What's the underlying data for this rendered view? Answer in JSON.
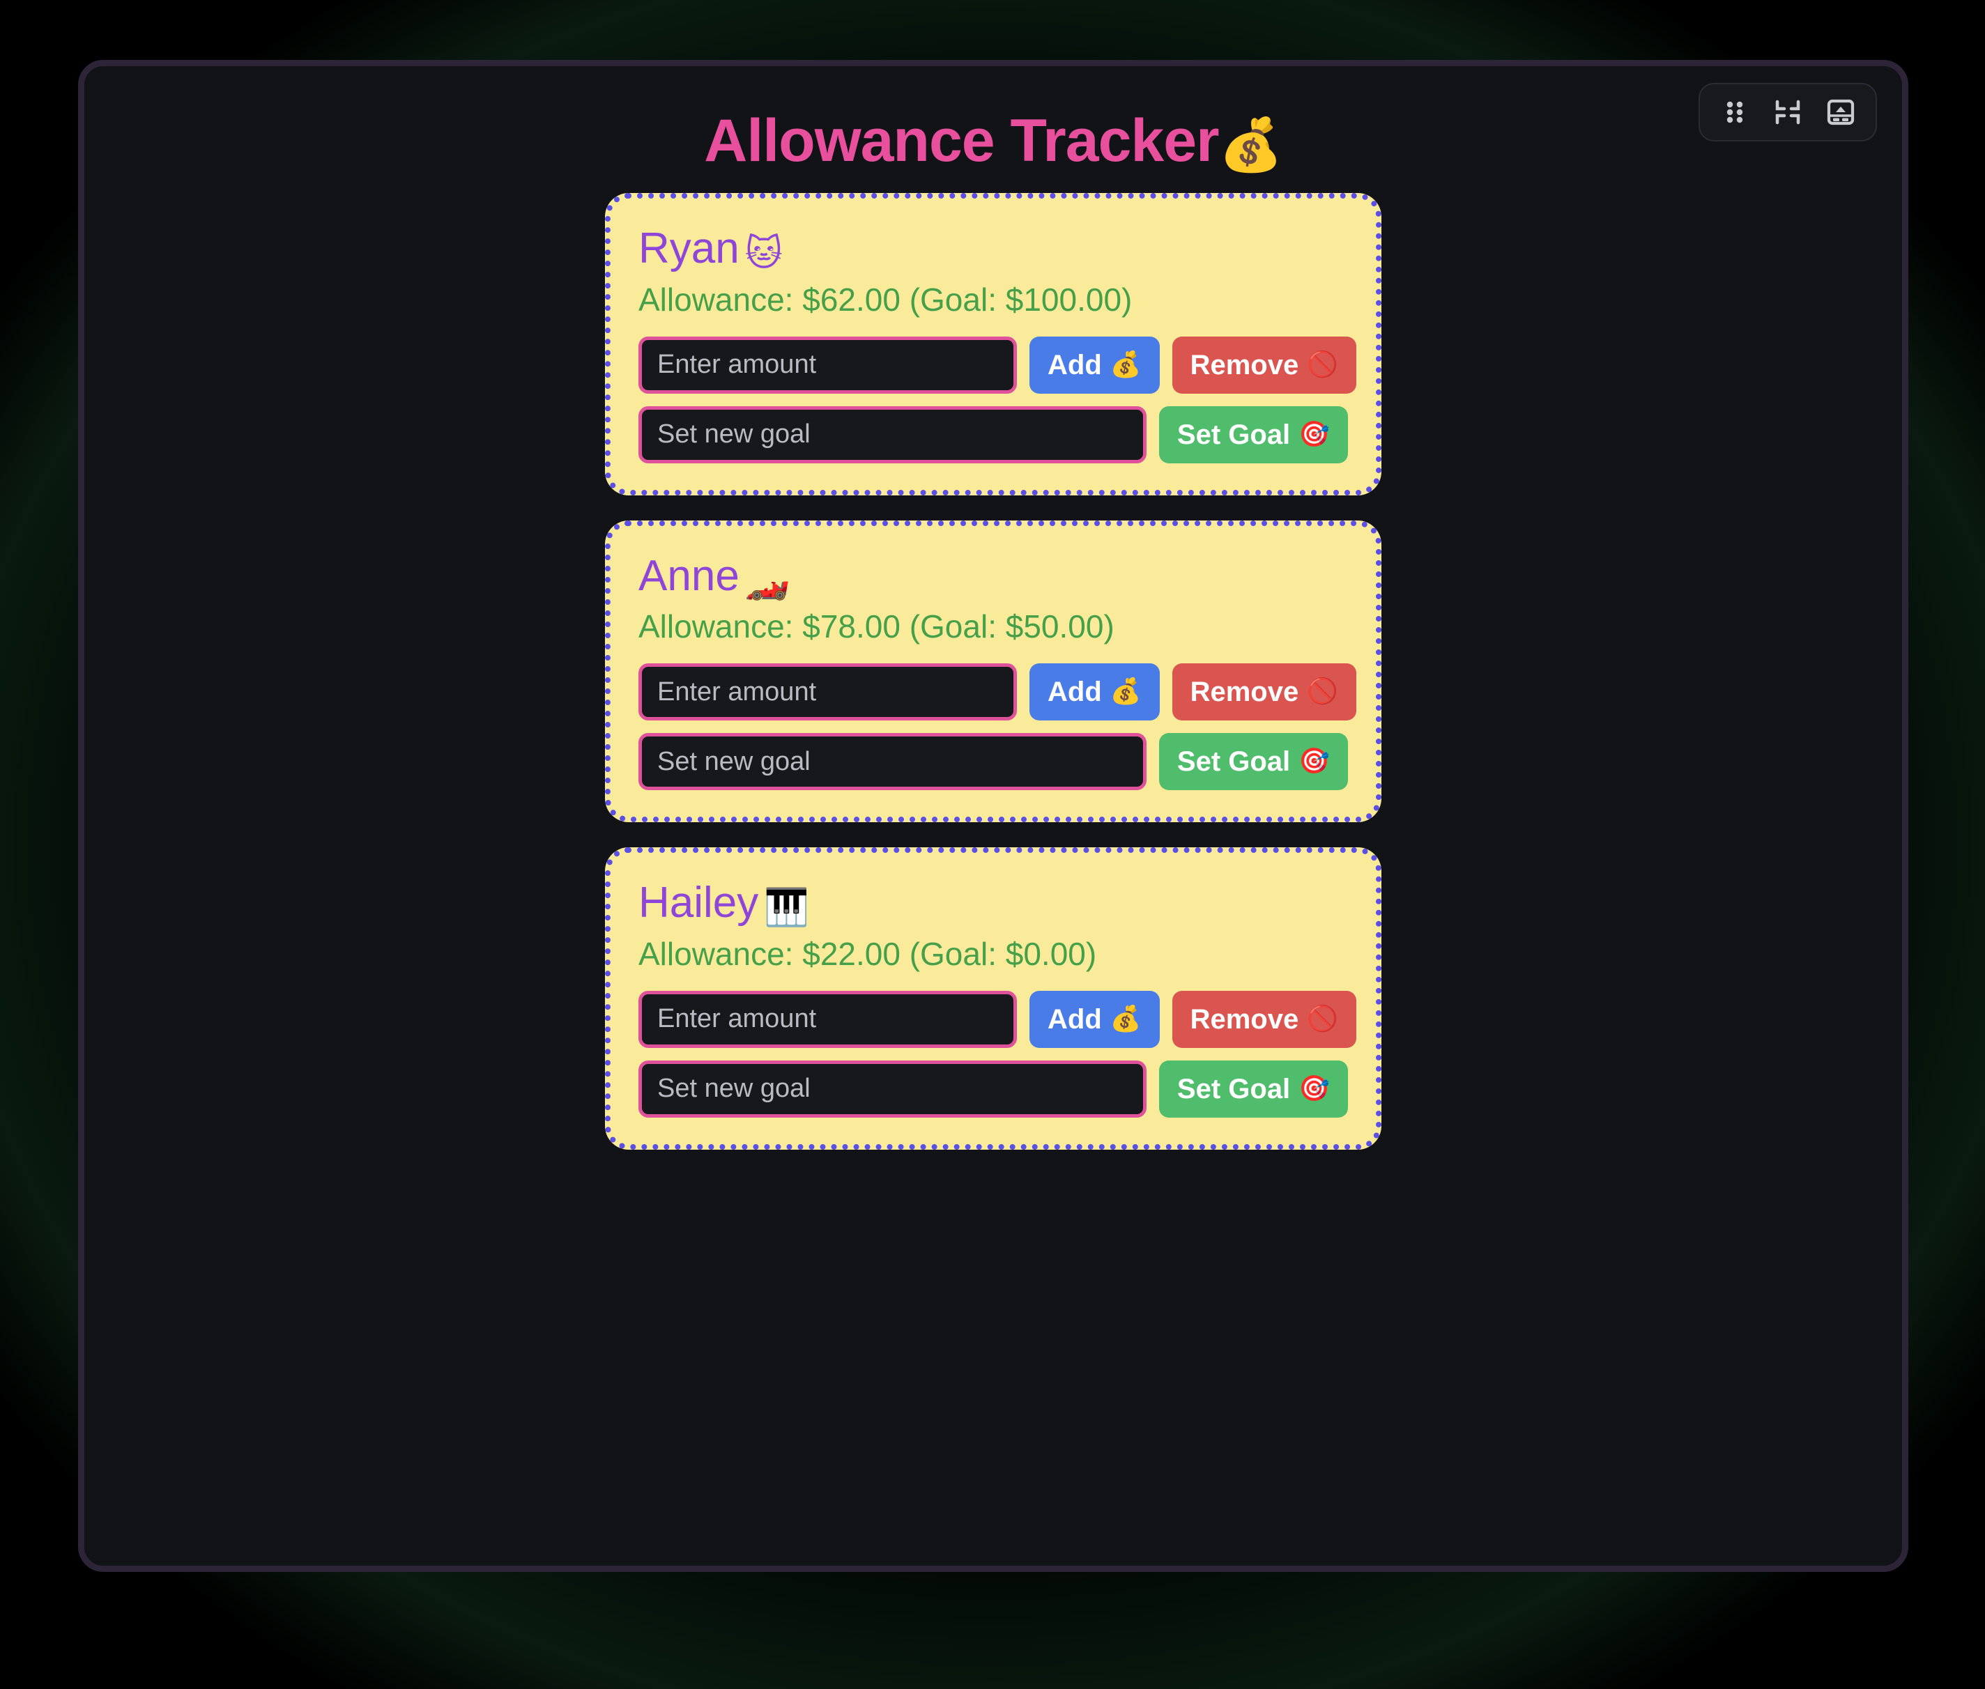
{
  "window": {
    "toolbar": {
      "drag_handle_name": "drag-handle-icon",
      "collapse_name": "collapse-icon",
      "dock_name": "dock-panel-icon"
    }
  },
  "header": {
    "title": "Allowance Tracker",
    "title_emoji": "💰"
  },
  "labels": {
    "amount_placeholder": "Enter amount",
    "goal_placeholder": "Set new goal",
    "add_label": "Add",
    "add_emoji": "💰",
    "remove_label": "Remove",
    "remove_emoji": "🚫",
    "set_goal_label": "Set Goal",
    "set_goal_emoji": "🎯"
  },
  "colors": {
    "page_background": "#121316",
    "window_border": "#2d2438",
    "title": "#e8509e",
    "card_background": "#faeb9b",
    "card_border": "#5b4fe6",
    "name": "#8e45d8",
    "allowance": "#46a049",
    "input_border": "#e0519c",
    "input_background": "#17181b",
    "add_button": "#4a7ce8",
    "remove_button": "#da5450",
    "set_goal_button": "#4fbd6b"
  },
  "kids": [
    {
      "name": "Ryan",
      "emoji": "🐱",
      "allowance_text": "Allowance: $62.00 (Goal: $100.00)",
      "allowance": 62.0,
      "goal": 100.0,
      "amount_value": "",
      "goal_value": ""
    },
    {
      "name": "Anne",
      "emoji": "🏎️",
      "allowance_text": "Allowance: $78.00 (Goal: $50.00)",
      "allowance": 78.0,
      "goal": 50.0,
      "amount_value": "",
      "goal_value": ""
    },
    {
      "name": "Hailey",
      "emoji": "🎹",
      "allowance_text": "Allowance: $22.00 (Goal: $0.00)",
      "allowance": 22.0,
      "goal": 0.0,
      "amount_value": "",
      "goal_value": ""
    }
  ]
}
